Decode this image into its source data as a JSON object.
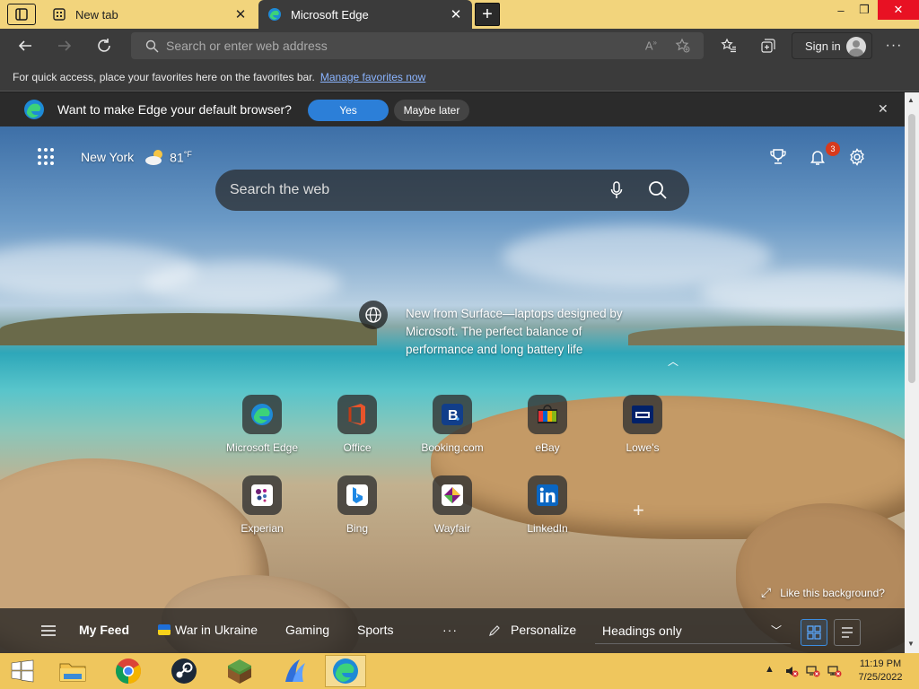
{
  "browser": {
    "tabs": [
      {
        "title": "New tab",
        "active": false
      },
      {
        "title": "Microsoft Edge",
        "active": true
      }
    ],
    "new_tab_symbol": "+",
    "window_controls": {
      "minimize": "–",
      "maximize": "❐",
      "close": "✕"
    },
    "address_placeholder": "Search or enter web address",
    "sign_in_label": "Sign in",
    "more_symbol": "···"
  },
  "favorites_bar": {
    "message": "For quick access, place your favorites here on the favorites bar.",
    "link": "Manage favorites now"
  },
  "default_banner": {
    "message": "Want to make Edge your default browser?",
    "yes_label": "Yes",
    "later_label": "Maybe later",
    "close_symbol": "✕"
  },
  "newtab": {
    "weather": {
      "city": "New York",
      "temp": "81",
      "unit": "°F"
    },
    "notification_count": "3",
    "search_placeholder": "Search the web",
    "promo": {
      "text": "New from Surface—laptops designed by Microsoft. The perfect balance of performance and long battery life"
    },
    "tiles_row1": [
      {
        "label": "Microsoft Edge",
        "icon": "edge-icon"
      },
      {
        "label": "Office",
        "icon": "office-icon"
      },
      {
        "label": "Booking.com",
        "icon": "booking-icon"
      },
      {
        "label": "eBay",
        "icon": "ebay-icon"
      },
      {
        "label": "Lowe's",
        "icon": "lowes-icon"
      }
    ],
    "tiles_row2": [
      {
        "label": "Experian",
        "icon": "experian-icon"
      },
      {
        "label": "Bing",
        "icon": "bing-icon"
      },
      {
        "label": "Wayfair",
        "icon": "wayfair-icon"
      },
      {
        "label": "LinkedIn",
        "icon": "linkedin-icon"
      }
    ],
    "add_symbol": "+",
    "like_background": "Like this background?",
    "feed": {
      "my_feed": "My Feed",
      "items": [
        "War in Ukraine",
        "Gaming",
        "Sports"
      ],
      "more": "···",
      "personalize": "Personalize",
      "headings_select": "Headings only"
    }
  },
  "taskbar": {
    "clock_time": "11:19 PM",
    "clock_date": "7/25/2022",
    "tray_chevron": "▲"
  },
  "colors": {
    "titlebar": "#f2d47c",
    "accent": "#2c7fd8",
    "taskbar": "#efc65d",
    "badge": "#d73a1d"
  }
}
